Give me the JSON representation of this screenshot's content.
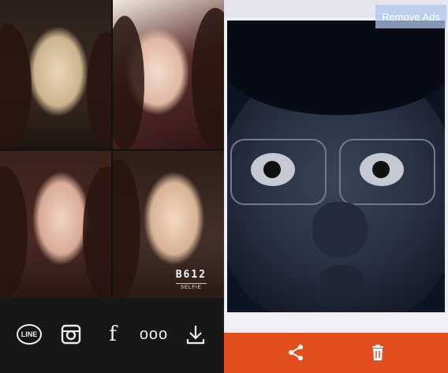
{
  "left_panel": {
    "watermark_title": "B612",
    "watermark_sub": "SELFIE",
    "toolbar": [
      {
        "icon": "line-icon",
        "label": "LINE"
      },
      {
        "icon": "instagram-icon"
      },
      {
        "icon": "facebook-icon",
        "label": "f"
      },
      {
        "icon": "more-icon",
        "label": "ooo"
      },
      {
        "icon": "download-icon"
      }
    ]
  },
  "right_panel": {
    "remove_ads_label": "Remove Ads",
    "bottom_bar": [
      {
        "icon": "share-icon"
      },
      {
        "icon": "trash-icon"
      }
    ],
    "colors": {
      "accent": "#e14f1f",
      "overlay_button": "#adc6e9"
    }
  }
}
